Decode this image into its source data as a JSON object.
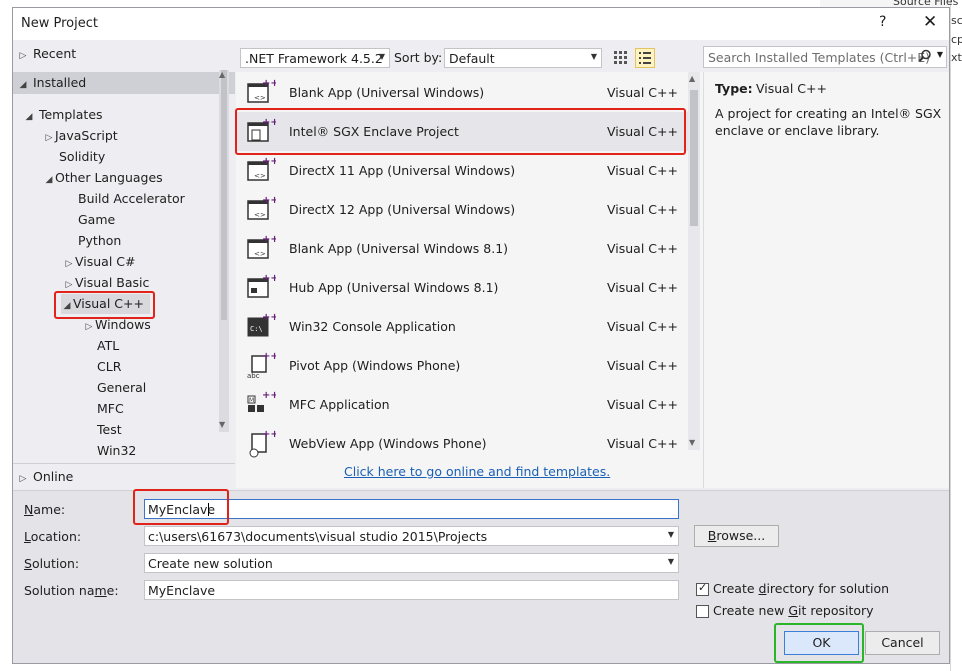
{
  "background_app": {
    "lines": [
      "Source Files",
      "sc",
      "cp",
      "xt"
    ]
  },
  "dialog": {
    "title": "New Project",
    "help_label": "?",
    "close_label": "✕"
  },
  "tree": {
    "recent": "Recent",
    "installed": "Installed",
    "templates": "Templates",
    "javascript": "JavaScript",
    "solidity": "Solidity",
    "other_languages": "Other Languages",
    "build_accelerator": "Build Accelerator",
    "game": "Game",
    "python": "Python",
    "visual_csharp": "Visual C#",
    "visual_basic": "Visual Basic",
    "visual_cpp": "Visual C++",
    "windows": "Windows",
    "atl": "ATL",
    "clr": "CLR",
    "general": "General",
    "mfc": "MFC",
    "test": "Test",
    "win32": "Win32",
    "online": "Online"
  },
  "toolbar": {
    "framework": ".NET Framework 4.5.2",
    "sort_label": "Sort by:",
    "sort_value": "Default",
    "search_placeholder": "Search Installed Templates (Ctrl+E)"
  },
  "templates": [
    {
      "name": "Blank App (Universal Windows)",
      "lang": "Visual C++",
      "icon": "blank-app-icon"
    },
    {
      "name": "Intel® SGX Enclave Project",
      "lang": "Visual C++",
      "icon": "sgx-enclave-icon"
    },
    {
      "name": "DirectX 11 App (Universal Windows)",
      "lang": "Visual C++",
      "icon": "directx-app-icon"
    },
    {
      "name": "DirectX 12 App (Universal Windows)",
      "lang": "Visual C++",
      "icon": "directx-app-icon"
    },
    {
      "name": "Blank App (Universal Windows 8.1)",
      "lang": "Visual C++",
      "icon": "blank-app-icon"
    },
    {
      "name": "Hub App (Universal Windows 8.1)",
      "lang": "Visual C++",
      "icon": "hub-app-icon"
    },
    {
      "name": "Win32 Console Application",
      "lang": "Visual C++",
      "icon": "console-app-icon"
    },
    {
      "name": "Pivot App (Windows Phone)",
      "lang": "Visual C++",
      "icon": "pivot-app-icon"
    },
    {
      "name": "MFC Application",
      "lang": "Visual C++",
      "icon": "mfc-app-icon"
    },
    {
      "name": "WebView App (Windows Phone)",
      "lang": "Visual C++",
      "icon": "webview-app-icon"
    }
  ],
  "online_link": "Click here to go online and find templates.",
  "details": {
    "type_label": "Type:",
    "type_value": "Visual C++",
    "description_line1": "A project for creating an Intel® SGX",
    "description_line2": "enclave or enclave library."
  },
  "form": {
    "name_label": "Name:",
    "name_value": "MyEnclave",
    "location_label": "Location:",
    "location_value": "c:\\users\\61673\\documents\\visual studio 2015\\Projects",
    "solution_label": "Solution:",
    "solution_value": "Create new solution",
    "solution_name_label": "Solution name:",
    "solution_name_value": "MyEnclave",
    "browse_label": "Browse...",
    "create_dir_label": "Create directory for solution",
    "create_dir_checked": true,
    "git_label": "Create new Git repository",
    "git_checked": false,
    "ok_label": "OK",
    "cancel_label": "Cancel"
  },
  "colors": {
    "highlight_red": "#e2231a",
    "highlight_green": "#2bb52b",
    "link": "#1a5fb4"
  }
}
